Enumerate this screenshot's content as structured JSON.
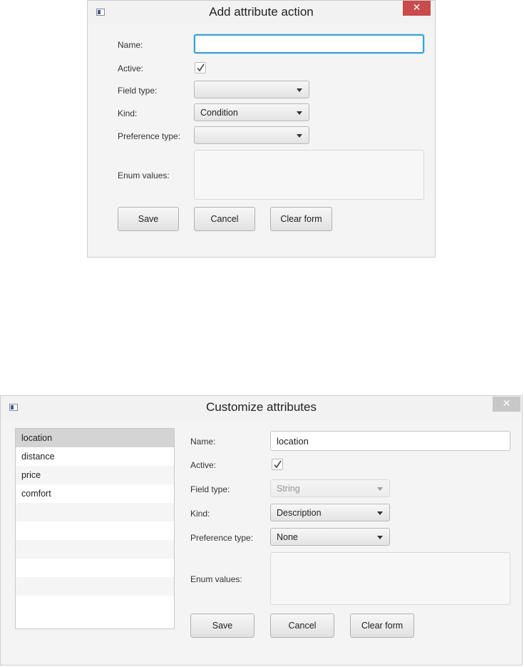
{
  "dialog_add": {
    "title": "Add attribute action",
    "close_glyph": "✕",
    "labels": {
      "name": "Name:",
      "active": "Active:",
      "field_type": "Field type:",
      "kind": "Kind:",
      "preference_type": "Preference type:",
      "enum_values": "Enum values:"
    },
    "name_value": "",
    "active_checked": true,
    "field_type_value": "",
    "kind_value": "Condition",
    "preference_type_value": "",
    "buttons": {
      "save": "Save",
      "cancel": "Cancel",
      "clear": "Clear form"
    }
  },
  "dialog_customize": {
    "title": "Customize attributes",
    "close_glyph": "✕",
    "attribute_list": [
      "location",
      "distance",
      "price",
      "comfort"
    ],
    "selected_attribute": "location",
    "labels": {
      "name": "Name:",
      "active": "Active:",
      "field_type": "Field type:",
      "kind": "Kind:",
      "preference_type": "Preference type:",
      "enum_values": "Enum values:"
    },
    "name_value": "location",
    "active_checked": true,
    "field_type_value": "String",
    "kind_value": "Description",
    "preference_type_value": "None",
    "buttons": {
      "save": "Save",
      "cancel": "Cancel",
      "clear": "Clear form"
    }
  },
  "colors": {
    "focus_ring": "#3aa0d6",
    "close_active": "#c94b4b",
    "close_inactive": "#c7c7c7",
    "list_selected": "#d4d4d4"
  },
  "icons": {
    "app": "window-app-icon",
    "close": "close-icon",
    "check": "checkmark-icon",
    "dropdown": "chevron-down-icon"
  }
}
